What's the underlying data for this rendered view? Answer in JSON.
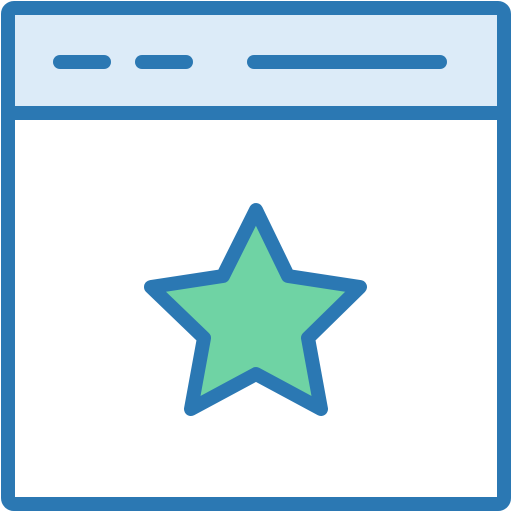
{
  "icon": {
    "name": "browser-window-favorite-icon",
    "style": "line-filled"
  },
  "colors": {
    "stroke": "#2b78b3",
    "title_bar_fill": "#dcebf8",
    "window_fill": "#ffffff",
    "star_fill": "#6fd3a4"
  },
  "window": {
    "title_bar": {
      "placeholders": [
        "short-dash",
        "short-dash",
        "long-bar"
      ]
    },
    "content": {
      "symbol": "star-icon"
    }
  }
}
